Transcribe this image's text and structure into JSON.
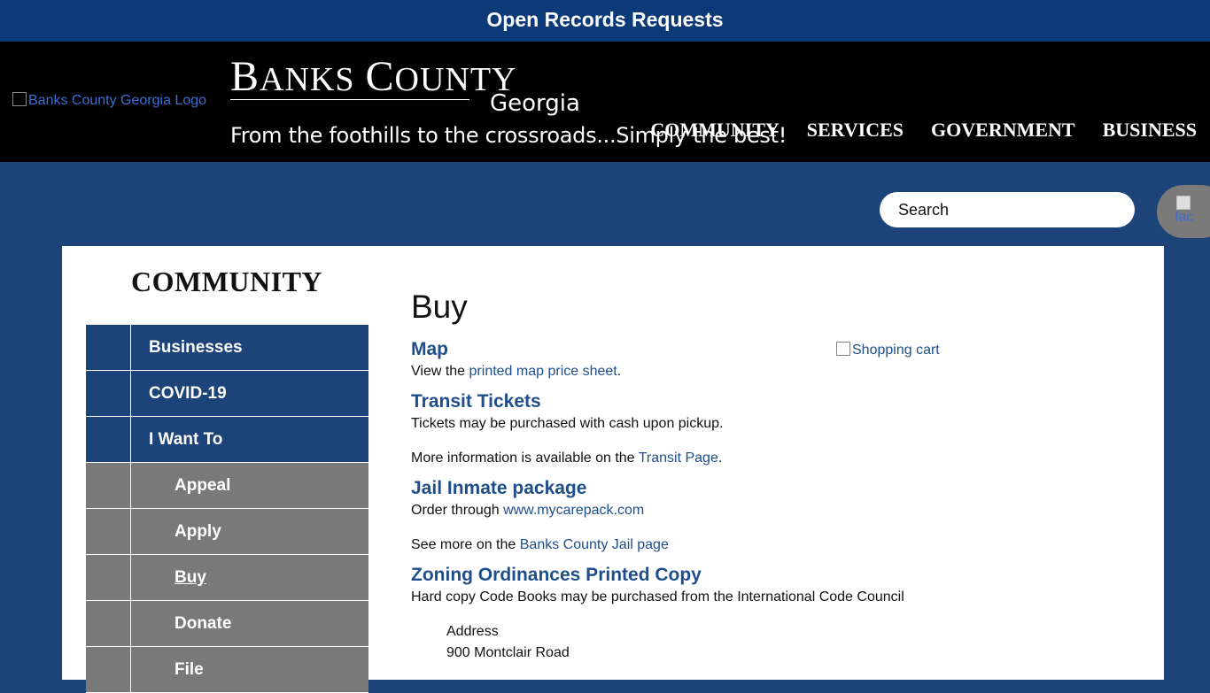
{
  "top_bar": {
    "label": "Open Records Requests"
  },
  "header": {
    "logo_alt": "Banks County Georgia Logo",
    "brand_first_letter_1": "B",
    "brand_rest_1": "ANKS",
    "brand_first_letter_2": "C",
    "brand_rest_2": "OUNTY",
    "brand_state": "Georgia",
    "tagline": "From the foothills to the crossroads...Simply the best!",
    "nav": [
      "COMMUNITY",
      "SERVICES",
      "GOVERNMENT",
      "BUSINESS"
    ]
  },
  "search": {
    "placeholder": "Search"
  },
  "facebook": {
    "alt": "fac"
  },
  "sidebar": {
    "title": "COMMUNITY",
    "items": [
      {
        "label": "Businesses",
        "level": "top"
      },
      {
        "label": "COVID-19",
        "level": "top"
      },
      {
        "label": "I Want To",
        "level": "top"
      },
      {
        "label": "Appeal",
        "level": "sub"
      },
      {
        "label": "Apply",
        "level": "sub"
      },
      {
        "label": "Buy",
        "level": "sub",
        "active": true
      },
      {
        "label": "Donate",
        "level": "sub"
      },
      {
        "label": "File",
        "level": "sub"
      }
    ]
  },
  "article": {
    "title": "Buy",
    "cart_alt": "Shopping cart",
    "map": {
      "heading": "Map",
      "text_before": "View the ",
      "link": "printed map price sheet",
      "text_after": "."
    },
    "transit": {
      "heading": "Transit Tickets",
      "text": "Tickets may be purchased with cash upon pickup.",
      "more_before": "More information is available on the ",
      "more_link": "Transit Page",
      "more_after": "."
    },
    "jail": {
      "heading": "Jail Inmate package",
      "order_before": "Order through ",
      "order_link": "www.mycarepack.com",
      "see_before": "See more on the ",
      "see_link": "Banks County Jail page"
    },
    "zoning": {
      "heading": "Zoning Ordinances Printed Copy",
      "text": "Hard copy Code Books may be purchased from the International Code Council",
      "address_label": "Address",
      "address_line1": "900 Montclair Road"
    }
  }
}
